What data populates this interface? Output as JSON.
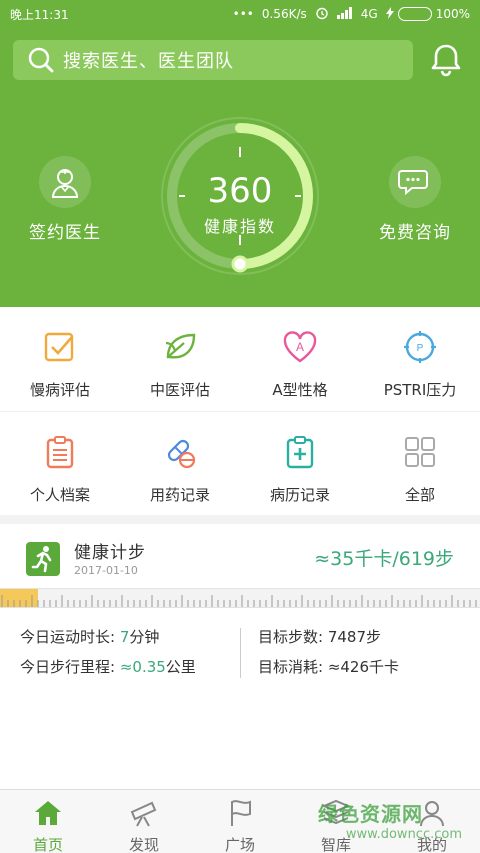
{
  "status_bar": {
    "time": "晚上11:31",
    "dots": "•••",
    "speed": "0.56K/s",
    "network": "4G",
    "battery": "100%"
  },
  "header": {
    "search_placeholder": "搜索医生、医生团队",
    "left_action": "签约医生",
    "right_action": "免费咨询",
    "gauge": {
      "score": "360",
      "label": "健康指数",
      "progress": 0.5
    }
  },
  "grid": {
    "row1": [
      {
        "label": "慢病评估",
        "icon": "checkbox-icon",
        "color": "#f2a93b"
      },
      {
        "label": "中医评估",
        "icon": "leaf-icon",
        "color": "#6cb33e"
      },
      {
        "label": "A型性格",
        "icon": "heart-a-icon",
        "color": "#e85a9a"
      },
      {
        "label": "PSTRI压力",
        "icon": "pressure-gauge-icon",
        "color": "#4aa8e0"
      }
    ],
    "row2": [
      {
        "label": "个人档案",
        "icon": "clipboard-icon",
        "color": "#f07a5a"
      },
      {
        "label": "用药记录",
        "icon": "pill-icon",
        "color": "#4a8ae0"
      },
      {
        "label": "病历记录",
        "icon": "medical-record-icon",
        "color": "#2ab0a0"
      },
      {
        "label": "全部",
        "icon": "grid-icon",
        "color": "#aaaaaa"
      }
    ]
  },
  "steps": {
    "title": "健康计步",
    "date": "2017-01-10",
    "summary": "≈35千卡/619步",
    "progress": 0.08,
    "stats": {
      "duration_label": "今日运动时长: ",
      "duration_value": "7",
      "duration_unit": "分钟",
      "distance_label": "今日步行里程: ",
      "distance_value": "≈0.35",
      "distance_unit": "公里",
      "target_steps": "目标步数: 7487步",
      "target_cal": "目标消耗: ≈426千卡"
    }
  },
  "tabbar": {
    "tabs": [
      {
        "label": "首页",
        "icon": "home-icon",
        "active": true
      },
      {
        "label": "发现",
        "icon": "telescope-icon",
        "active": false
      },
      {
        "label": "广场",
        "icon": "flag-icon",
        "active": false
      },
      {
        "label": "智库",
        "icon": "books-icon",
        "active": false
      },
      {
        "label": "我的",
        "icon": "user-icon",
        "active": false
      }
    ]
  },
  "watermark": {
    "line1": "绿色资源网",
    "line2": "www.downcc.com"
  },
  "colors": {
    "brand_green": "#6cb33e",
    "accent_teal": "#3aa87a"
  }
}
